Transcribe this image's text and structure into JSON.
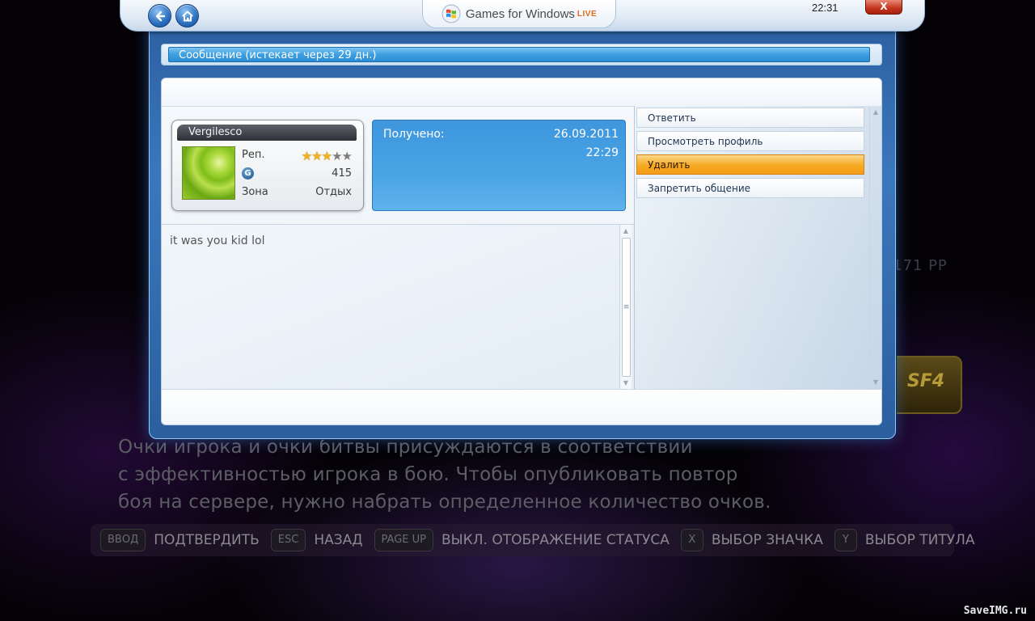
{
  "window": {
    "logo_text": "Games for Windows",
    "logo_live": "LIVE",
    "clock": "22:31",
    "close_label": "X"
  },
  "message": {
    "title": "Сообщение (истекает через 29 дн.)",
    "received_label": "Получено:",
    "received_date": "26.09.2011",
    "received_time": "22:29",
    "body": "it was you kid lol"
  },
  "gamercard": {
    "gamertag": "Vergilesco",
    "rep_label": "Реп.",
    "rep_stars_filled": 3,
    "rep_stars_total": 5,
    "gamerscore": "415",
    "zone_label": "Зона",
    "zone_value": "Отдых"
  },
  "actions": [
    {
      "label": "Ответить",
      "selected": false
    },
    {
      "label": "Просмотреть профиль",
      "selected": false
    },
    {
      "label": "Удалить",
      "selected": true
    },
    {
      "label": "Запретить общение",
      "selected": false
    }
  ],
  "background": {
    "score_text": "171 PP",
    "logo_text": "SF4",
    "hint_lines": [
      "Очки игрока и очки битвы присуждаются в соответствии",
      "с эффективностью игрока в бою. Чтобы опубликовать повтор",
      "боя на сервере, нужно набрать определенное количество очков."
    ],
    "controls": [
      {
        "key": "ВВОД",
        "label": "ПОДТВЕРДИТЬ"
      },
      {
        "key": "ESC",
        "label": "НАЗАД"
      },
      {
        "key": "PAGE UP",
        "label": "ВЫКЛ. ОТОБРАЖЕНИЕ СТАТУСА"
      },
      {
        "key": "X",
        "label": "ВЫБОР ЗНАЧКА"
      },
      {
        "key": "Y",
        "label": "ВЫБОР ТИТУЛА"
      }
    ],
    "watermark": "SaveIMG.ru"
  },
  "colors": {
    "accent_blue": "#3d9fe0",
    "selected_orange": "#f7a923",
    "close_red": "#c3341c"
  }
}
